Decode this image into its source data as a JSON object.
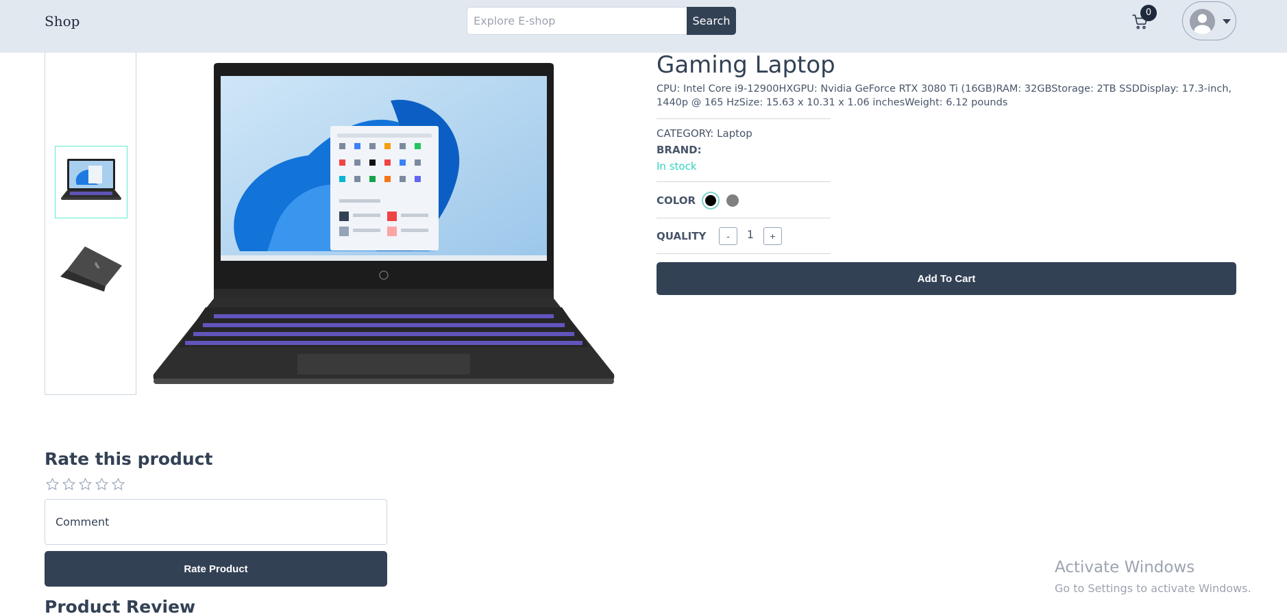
{
  "header": {
    "logo": "Shop",
    "search_placeholder": "Explore E-shop",
    "search_button": "Search",
    "cart_count": "0",
    "icons": {
      "cart": "cart-icon",
      "account": "user-avatar-icon",
      "caret": "caret-down-icon"
    }
  },
  "gallery": {
    "thumbnails": [
      {
        "alt": "Gaming laptop front view",
        "selected": true
      },
      {
        "alt": "Gaming laptop back view",
        "selected": false
      }
    ]
  },
  "product": {
    "name": "Gaming Laptop",
    "description": "CPU: Intel Core i9-12900HXGPU: Nvidia GeForce RTX 3080 Ti (16GB)RAM: 32GBStorage: 2TB SSDDisplay: 17.3-inch, 1440p @ 165 HzSize: 15.63 x 10.31 x 1.06 inchesWeight: 6.12 pounds",
    "category_label": "CATEGORY:",
    "category_value": "Laptop",
    "brand_label": "BRAND:",
    "brand_value": "",
    "stock_status": "In stock",
    "color_label": "COLOR",
    "colors": [
      {
        "name": "black",
        "hex": "#000000",
        "selected": true
      },
      {
        "name": "gray",
        "hex": "#808080",
        "selected": false
      }
    ],
    "quantity_label": "QUALITY",
    "quantity_minus": "-",
    "quantity_value": "1",
    "quantity_plus": "+",
    "add_to_cart": "Add To Cart"
  },
  "rating": {
    "title": "Rate this product",
    "stars_selected": 0,
    "stars_total": 5,
    "comment_placeholder": "Comment",
    "submit": "Rate Product"
  },
  "reviews": {
    "title": "Product Review"
  },
  "watermark": {
    "line1": "Activate Windows",
    "line2": "Go to Settings to activate Windows."
  },
  "colors": {
    "primary": "#334155",
    "header_bg": "#e2e8f0",
    "accent": "#2dd4bf"
  }
}
